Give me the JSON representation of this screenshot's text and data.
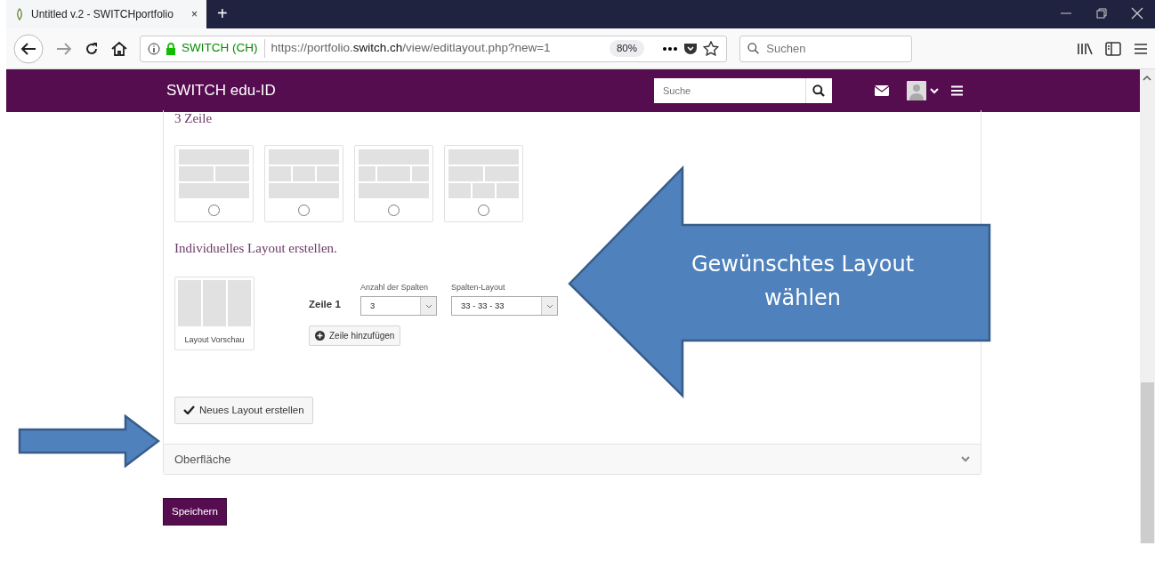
{
  "browser": {
    "tab": {
      "title": "Untitled v.2 - SWITCHportfolio",
      "close": "×"
    },
    "new_tab": "+",
    "url": {
      "identity": "SWITCH (CH)",
      "prefix": "https://portfolio.",
      "domain": "switch.ch",
      "path": "/view/editlayout.php?new=1"
    },
    "zoom": "80%",
    "search": {
      "placeholder": "Suchen"
    }
  },
  "site_header": {
    "brand": "SWITCH edu-ID",
    "search": {
      "placeholder": "Suche"
    }
  },
  "layout_section": {
    "heading": "3 Zeile",
    "options": [
      {
        "rows": [
          {
            "kind": "single"
          },
          {
            "kind": "halves"
          },
          {
            "kind": "single"
          }
        ],
        "selected": false
      },
      {
        "rows": [
          {
            "kind": "single"
          },
          {
            "kind": "thirds"
          },
          {
            "kind": "single"
          }
        ],
        "selected": false
      },
      {
        "rows": [
          {
            "kind": "single"
          },
          {
            "kind": "centered"
          },
          {
            "kind": "single"
          }
        ],
        "selected": false
      },
      {
        "rows": [
          {
            "kind": "single"
          },
          {
            "kind": "halves"
          },
          {
            "kind": "thirds"
          }
        ],
        "selected": false
      }
    ]
  },
  "custom_layout": {
    "title": "Individuelles Layout erstellen.",
    "preview": {
      "kind": "thirds",
      "label": "Layout Vorschau"
    },
    "row_label": "Zeile 1",
    "columns_field": {
      "label": "Anzahl der Spalten",
      "value": "3"
    },
    "layout_field": {
      "label": "Spalten-Layout",
      "value": "33 - 33 - 33"
    },
    "add_row_button": "Zeile hinzufügen",
    "create_button": "Neues Layout erstellen"
  },
  "accordion": {
    "title": "Oberfläche",
    "expanded": false
  },
  "save_button": "Speichern",
  "annotations": [
    {
      "kind": "callout",
      "text": "Gewünschtes Layout wählen"
    },
    {
      "kind": "arrow"
    }
  ]
}
